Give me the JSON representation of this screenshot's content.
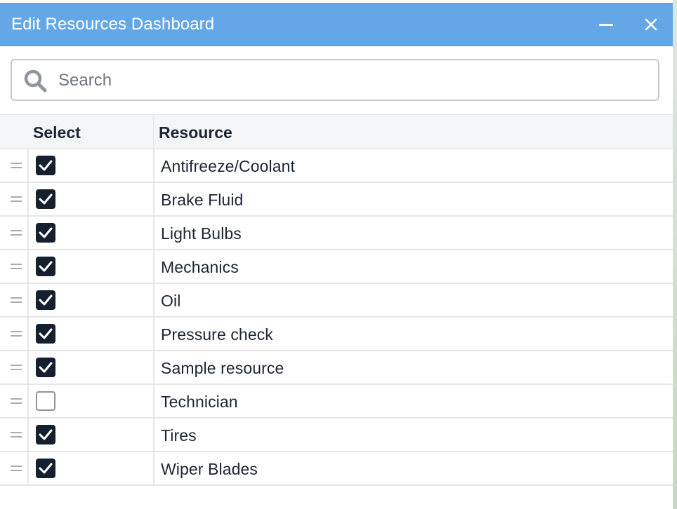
{
  "window": {
    "title": "Edit Resources Dashboard"
  },
  "search": {
    "placeholder": "Search",
    "value": ""
  },
  "table": {
    "headers": {
      "select": "Select",
      "resource": "Resource"
    },
    "rows": [
      {
        "resource": "Antifreeze/Coolant",
        "selected": true
      },
      {
        "resource": "Brake Fluid",
        "selected": true
      },
      {
        "resource": "Light Bulbs",
        "selected": true
      },
      {
        "resource": "Mechanics",
        "selected": true
      },
      {
        "resource": "Oil",
        "selected": true
      },
      {
        "resource": "Pressure check",
        "selected": true
      },
      {
        "resource": "Sample resource",
        "selected": true
      },
      {
        "resource": "Technician",
        "selected": false
      },
      {
        "resource": "Tires",
        "selected": true
      },
      {
        "resource": "Wiper Blades",
        "selected": true
      }
    ]
  },
  "icons": {
    "minimize": "minimize-icon",
    "close": "close-icon",
    "search": "search-icon",
    "drag": "drag-handle-icon",
    "check": "checkmark-icon"
  },
  "colors": {
    "titlebar": "#64a7e6",
    "checkbox_checked": "#15202e",
    "text": "#1c2533"
  }
}
